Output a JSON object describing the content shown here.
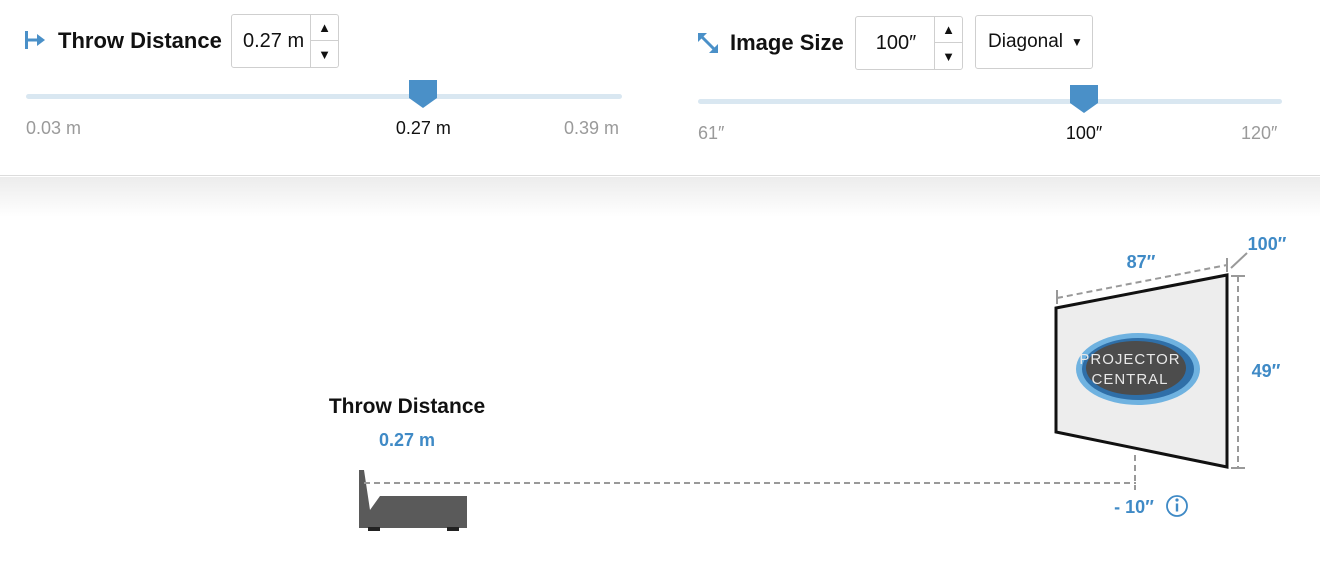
{
  "throw": {
    "title": "Throw Distance",
    "value": "0.27 m",
    "slider": {
      "min_label": "0.03 m",
      "current_label": "0.27 m",
      "max_label": "0.39 m",
      "min": 0.03,
      "max": 0.39,
      "value": 0.27
    }
  },
  "image": {
    "title": "Image Size",
    "value": "100″",
    "mode": "Diagonal",
    "slider": {
      "min_label": "61″",
      "current_label": "100″",
      "max_label": "120″",
      "min": 61,
      "max": 120,
      "value": 100
    }
  },
  "diagram": {
    "throw_title": "Throw Distance",
    "throw_value": "0.27 m",
    "width_label": "87″",
    "diagonal_label": "100″",
    "height_label": "49″",
    "offset_label": "- 10″",
    "logo_line1": "PROJECTOR",
    "logo_line2": "CENTRAL"
  },
  "colors": {
    "accent": "#4a90c8",
    "label_blue": "#3f8ac6",
    "track": "#d9e7f1",
    "projector": "#5a5a5a",
    "screen_fill": "#ededed"
  },
  "icons": {
    "throw": "arrow-right-from-bar-icon",
    "image": "diagonal-resize-icon",
    "info": "info-icon"
  }
}
